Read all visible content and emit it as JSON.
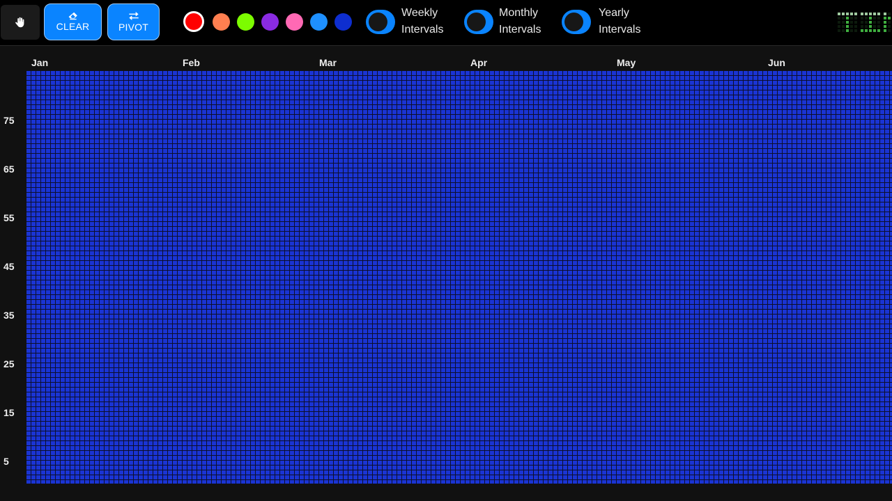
{
  "toolbar": {
    "hand_tool": {
      "icon": "hand-icon"
    },
    "clear_button": {
      "label": "CLEAR",
      "icon": "eraser-icon"
    },
    "pivot_button": {
      "label": "PIVOT",
      "icon": "swap-arrows-icon"
    },
    "colors": [
      {
        "name": "red",
        "hex": "#ff0000",
        "selected": true
      },
      {
        "name": "orange",
        "hex": "#ff7f50",
        "selected": false
      },
      {
        "name": "lime",
        "hex": "#7cfc00",
        "selected": false
      },
      {
        "name": "purple",
        "hex": "#8a2be2",
        "selected": false
      },
      {
        "name": "pink",
        "hex": "#ff69b4",
        "selected": false
      },
      {
        "name": "sky-blue",
        "hex": "#1e90ff",
        "selected": false
      },
      {
        "name": "blue",
        "hex": "#0e2ed0",
        "selected": false
      }
    ],
    "toggles": [
      {
        "line1": "Weekly",
        "line2": "Intervals",
        "on": false
      },
      {
        "line1": "Monthly",
        "line2": "Intervals",
        "on": false
      },
      {
        "line1": "Yearly",
        "line2": "Intervals",
        "on": false
      }
    ],
    "logo_text": "TIM"
  },
  "grid": {
    "months": [
      "Jan",
      "Feb",
      "Mar",
      "Apr",
      "May",
      "Jun"
    ],
    "y_labels": [
      "75",
      "65",
      "55",
      "45",
      "35",
      "25",
      "15",
      "5"
    ],
    "cell_color": "#1a34d4"
  }
}
